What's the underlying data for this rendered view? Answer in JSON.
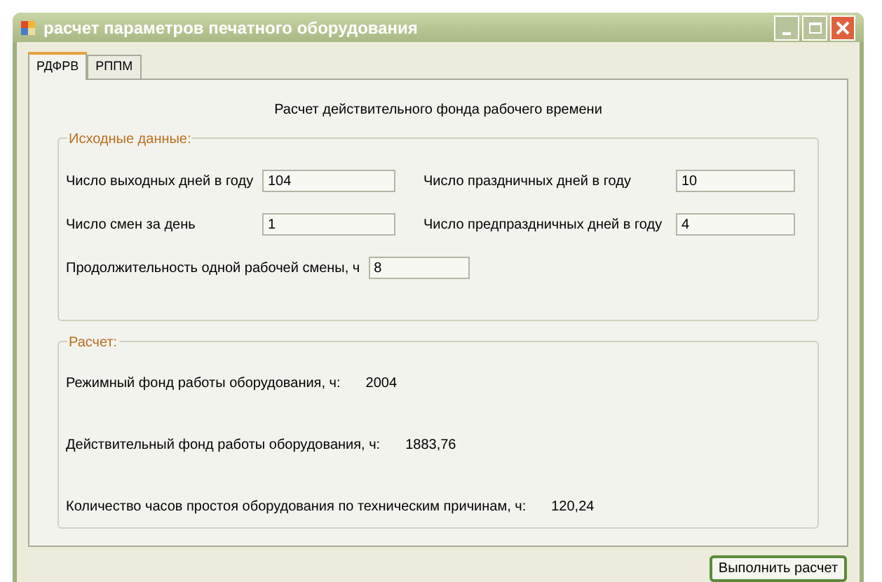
{
  "window": {
    "title": "расчет параметров печатного оборудования"
  },
  "tabs": [
    {
      "label": "РДФРВ",
      "selected": true
    },
    {
      "label": "РППМ",
      "selected": false
    }
  ],
  "heading": "Расчет действительного фонда рабочего времени",
  "input_group": {
    "title": "Исходные данные:",
    "fields": [
      {
        "label": "Число выходных дней в году",
        "value": "104"
      },
      {
        "label": "Число праздничных дней в году",
        "value": "10"
      },
      {
        "label": "Число смен за день",
        "value": "1"
      },
      {
        "label": "Число предпраздничных дней в году",
        "value": "4"
      },
      {
        "label": "Продолжительность одной рабочей смены, ч",
        "value": "8"
      }
    ]
  },
  "result_group": {
    "title": "Расчет:",
    "results": [
      {
        "label": "Режимный фонд работы оборудования, ч:",
        "value": "2004"
      },
      {
        "label": "Действительный фонд работы оборудования, ч:",
        "value": "1883,76"
      },
      {
        "label": "Количество часов простоя оборудования по техническим причинам, ч:",
        "value": "120,24"
      }
    ]
  },
  "run_button": "Выполнить расчет"
}
